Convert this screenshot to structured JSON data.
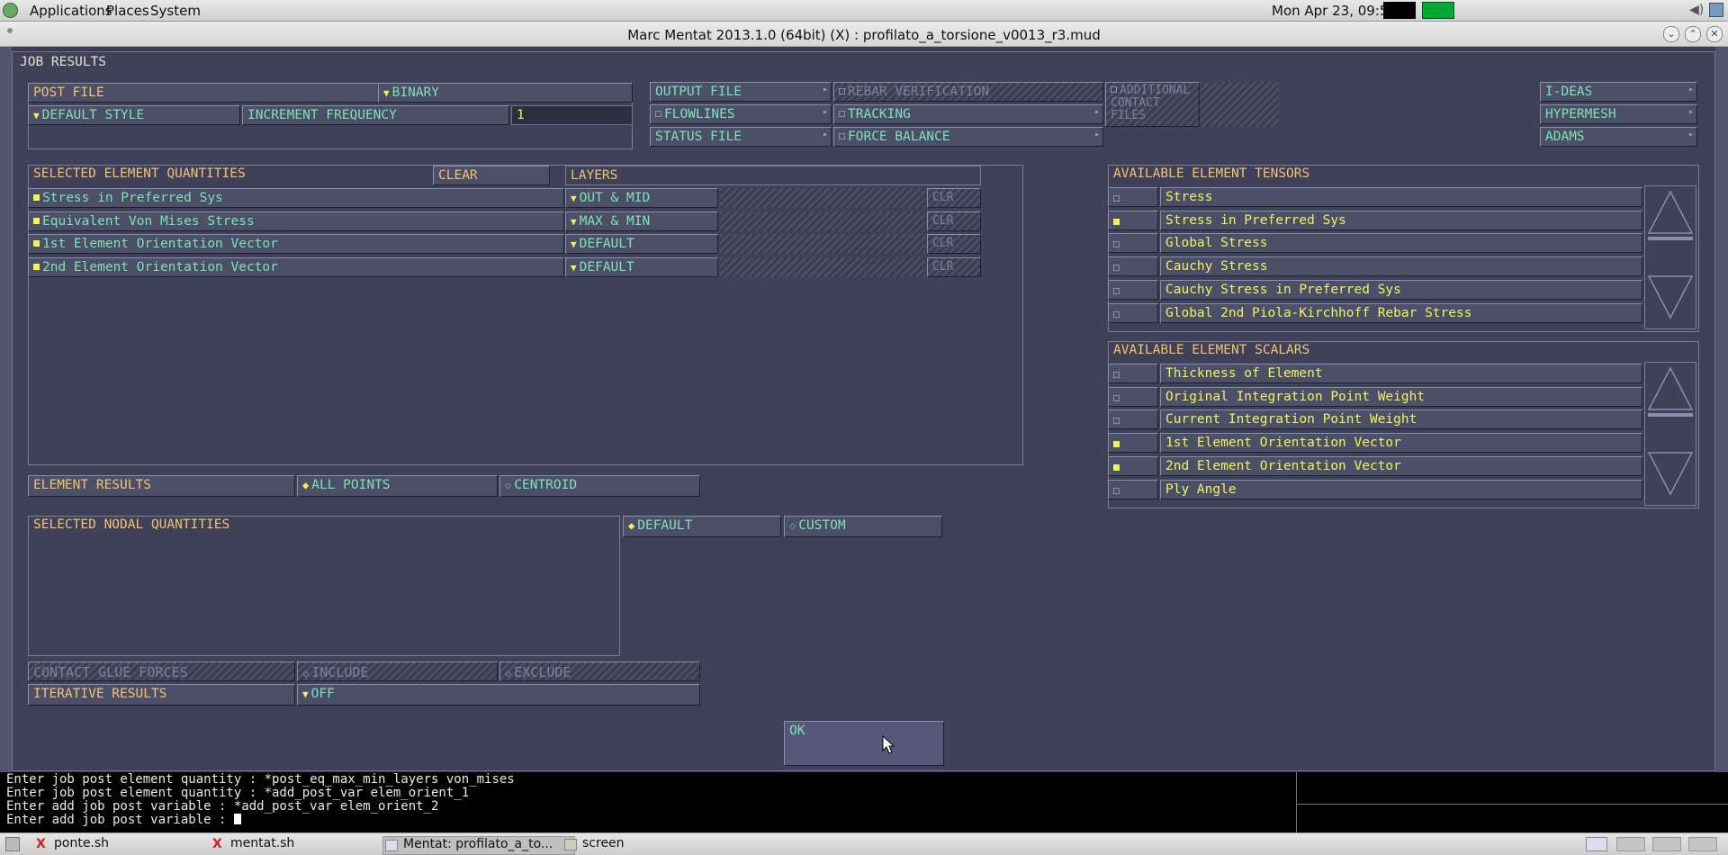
{
  "system_panel": {
    "menus": [
      "Applications",
      "Places",
      "System"
    ],
    "clock": "Mon Apr 23, 09:55"
  },
  "window": {
    "title": "Marc Mentat 2013.1.0 (64bit) (X) : profilato_a_torsione_v0013_r3.mud"
  },
  "dialog": {
    "title": "JOB RESULTS",
    "post_file_label": "POST FILE",
    "post_file_value": "BINARY",
    "default_style": "DEFAULT STYLE",
    "increment_frequency_label": "INCREMENT FREQUENCY",
    "increment_frequency_value": "1",
    "output_file": "OUTPUT FILE",
    "rebar_verification": "REBAR VERIFICATION",
    "additional_contact_files": "ADDITIONAL CONTACT FILES",
    "flowlines": "FLOWLINES",
    "tracking": "TRACKING",
    "status_file": "STATUS FILE",
    "force_balance": "FORCE BALANCE",
    "i_deas": "I-DEAS",
    "hypermesh": "HYPERMESH",
    "adams": "ADAMS",
    "selected_element_quantities": "SELECTED ELEMENT QUANTITIES",
    "clear": "CLEAR",
    "layers": "LAYERS",
    "clr": "CLR",
    "selected_rows": [
      {
        "name": "Stress in Preferred Sys",
        "layer": "OUT & MID"
      },
      {
        "name": "Equivalent Von Mises Stress",
        "layer": "MAX & MIN"
      },
      {
        "name": "1st Element Orientation Vector",
        "layer": "DEFAULT"
      },
      {
        "name": "2nd Element Orientation Vector",
        "layer": "DEFAULT"
      }
    ],
    "available_tensors_title": "AVAILABLE ELEMENT TENSORS",
    "available_tensors": [
      {
        "name": "Stress",
        "checked": false
      },
      {
        "name": "Stress in Preferred Sys",
        "checked": true
      },
      {
        "name": "Global Stress",
        "checked": false
      },
      {
        "name": "Cauchy Stress",
        "checked": false
      },
      {
        "name": "Cauchy Stress in Preferred Sys",
        "checked": false
      },
      {
        "name": "Global 2nd Piola-Kirchhoff Rebar Stress",
        "checked": false
      }
    ],
    "available_scalars_title": "AVAILABLE ELEMENT SCALARS",
    "available_scalars": [
      {
        "name": "Thickness of Element",
        "checked": false
      },
      {
        "name": "Original Integration Point Weight",
        "checked": false
      },
      {
        "name": "Current Integration Point Weight",
        "checked": false
      },
      {
        "name": "1st Element Orientation Vector",
        "checked": true
      },
      {
        "name": "2nd Element Orientation Vector",
        "checked": true
      },
      {
        "name": "Ply Angle",
        "checked": false
      }
    ],
    "element_results_label": "ELEMENT RESULTS",
    "all_points": "ALL POINTS",
    "centroid": "CENTROID",
    "selected_nodal_quantities": "SELECTED NODAL QUANTITIES",
    "nodal_default": "DEFAULT",
    "nodal_custom": "CUSTOM",
    "contact_glue_forces": "CONTACT GLUE FORCES",
    "include": "INCLUDE",
    "exclude": "EXCLUDE",
    "iterative_results_label": "ITERATIVE RESULTS",
    "iterative_results_value": "OFF",
    "ok": "OK"
  },
  "terminal": {
    "lines": [
      "Enter job post element quantity : *post_eq_max_min_layers von_mises",
      "Enter job post element quantity : *add_post_var elem_orient_1",
      "Enter add job post variable : *add_post_var elem_orient_2",
      "Enter add job post variable : "
    ]
  },
  "taskbar": {
    "items": [
      "ponte.sh",
      "mentat.sh",
      "Mentat: profilato_a_to...",
      "screen"
    ]
  },
  "colors": {
    "label": "#f3c26e",
    "value": "#7de3b3",
    "check": "#f2f25a",
    "dialog_bg": "#3e4158"
  }
}
